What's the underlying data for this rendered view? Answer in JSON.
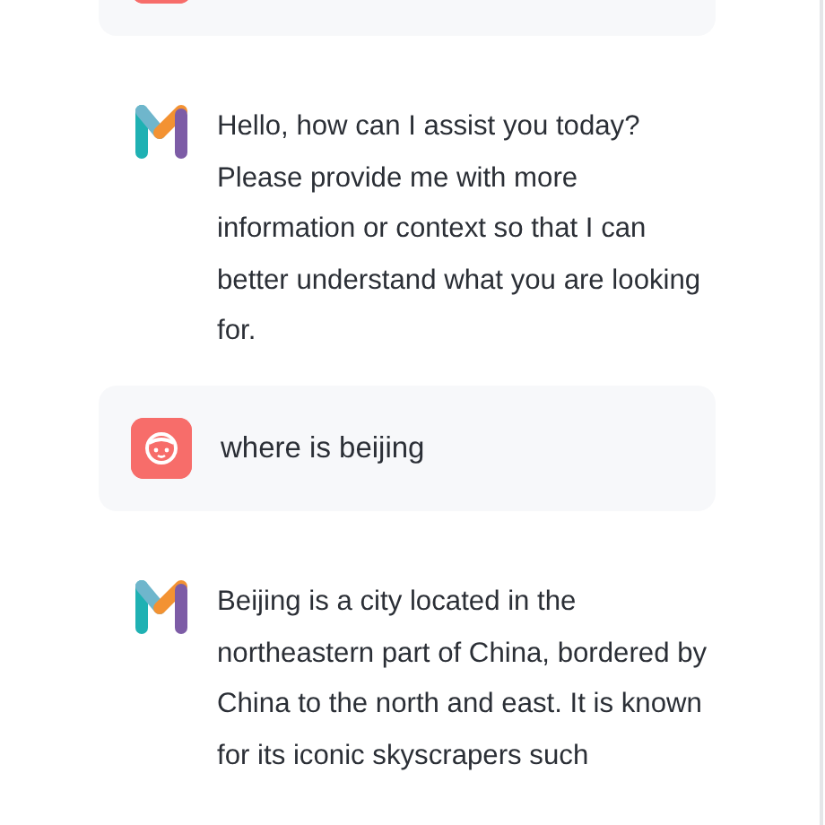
{
  "messages": [
    {
      "kind": "user"
    },
    {
      "kind": "assistant",
      "text": "Hello, how can I assist you today? Please provide me with more information or context so that I can better understand what you are looking for."
    },
    {
      "kind": "user",
      "text": "where is beijing"
    },
    {
      "kind": "assistant",
      "text": "Beijing is a city located in the northeastern part of China, bordered by China to the north and east. It is known for its iconic skyscrapers such"
    }
  ]
}
